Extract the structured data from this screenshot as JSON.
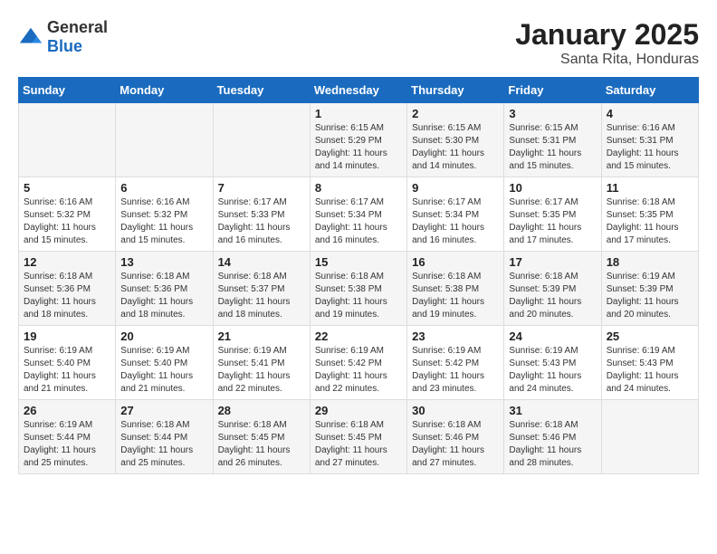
{
  "header": {
    "logo_general": "General",
    "logo_blue": "Blue",
    "month": "January 2025",
    "location": "Santa Rita, Honduras"
  },
  "days_of_week": [
    "Sunday",
    "Monday",
    "Tuesday",
    "Wednesday",
    "Thursday",
    "Friday",
    "Saturday"
  ],
  "weeks": [
    [
      {
        "day": "",
        "content": ""
      },
      {
        "day": "",
        "content": ""
      },
      {
        "day": "",
        "content": ""
      },
      {
        "day": "1",
        "content": "Sunrise: 6:15 AM\nSunset: 5:29 PM\nDaylight: 11 hours and 14 minutes."
      },
      {
        "day": "2",
        "content": "Sunrise: 6:15 AM\nSunset: 5:30 PM\nDaylight: 11 hours and 14 minutes."
      },
      {
        "day": "3",
        "content": "Sunrise: 6:15 AM\nSunset: 5:31 PM\nDaylight: 11 hours and 15 minutes."
      },
      {
        "day": "4",
        "content": "Sunrise: 6:16 AM\nSunset: 5:31 PM\nDaylight: 11 hours and 15 minutes."
      }
    ],
    [
      {
        "day": "5",
        "content": "Sunrise: 6:16 AM\nSunset: 5:32 PM\nDaylight: 11 hours and 15 minutes."
      },
      {
        "day": "6",
        "content": "Sunrise: 6:16 AM\nSunset: 5:32 PM\nDaylight: 11 hours and 15 minutes."
      },
      {
        "day": "7",
        "content": "Sunrise: 6:17 AM\nSunset: 5:33 PM\nDaylight: 11 hours and 16 minutes."
      },
      {
        "day": "8",
        "content": "Sunrise: 6:17 AM\nSunset: 5:34 PM\nDaylight: 11 hours and 16 minutes."
      },
      {
        "day": "9",
        "content": "Sunrise: 6:17 AM\nSunset: 5:34 PM\nDaylight: 11 hours and 16 minutes."
      },
      {
        "day": "10",
        "content": "Sunrise: 6:17 AM\nSunset: 5:35 PM\nDaylight: 11 hours and 17 minutes."
      },
      {
        "day": "11",
        "content": "Sunrise: 6:18 AM\nSunset: 5:35 PM\nDaylight: 11 hours and 17 minutes."
      }
    ],
    [
      {
        "day": "12",
        "content": "Sunrise: 6:18 AM\nSunset: 5:36 PM\nDaylight: 11 hours and 18 minutes."
      },
      {
        "day": "13",
        "content": "Sunrise: 6:18 AM\nSunset: 5:36 PM\nDaylight: 11 hours and 18 minutes."
      },
      {
        "day": "14",
        "content": "Sunrise: 6:18 AM\nSunset: 5:37 PM\nDaylight: 11 hours and 18 minutes."
      },
      {
        "day": "15",
        "content": "Sunrise: 6:18 AM\nSunset: 5:38 PM\nDaylight: 11 hours and 19 minutes."
      },
      {
        "day": "16",
        "content": "Sunrise: 6:18 AM\nSunset: 5:38 PM\nDaylight: 11 hours and 19 minutes."
      },
      {
        "day": "17",
        "content": "Sunrise: 6:18 AM\nSunset: 5:39 PM\nDaylight: 11 hours and 20 minutes."
      },
      {
        "day": "18",
        "content": "Sunrise: 6:19 AM\nSunset: 5:39 PM\nDaylight: 11 hours and 20 minutes."
      }
    ],
    [
      {
        "day": "19",
        "content": "Sunrise: 6:19 AM\nSunset: 5:40 PM\nDaylight: 11 hours and 21 minutes."
      },
      {
        "day": "20",
        "content": "Sunrise: 6:19 AM\nSunset: 5:40 PM\nDaylight: 11 hours and 21 minutes."
      },
      {
        "day": "21",
        "content": "Sunrise: 6:19 AM\nSunset: 5:41 PM\nDaylight: 11 hours and 22 minutes."
      },
      {
        "day": "22",
        "content": "Sunrise: 6:19 AM\nSunset: 5:42 PM\nDaylight: 11 hours and 22 minutes."
      },
      {
        "day": "23",
        "content": "Sunrise: 6:19 AM\nSunset: 5:42 PM\nDaylight: 11 hours and 23 minutes."
      },
      {
        "day": "24",
        "content": "Sunrise: 6:19 AM\nSunset: 5:43 PM\nDaylight: 11 hours and 24 minutes."
      },
      {
        "day": "25",
        "content": "Sunrise: 6:19 AM\nSunset: 5:43 PM\nDaylight: 11 hours and 24 minutes."
      }
    ],
    [
      {
        "day": "26",
        "content": "Sunrise: 6:19 AM\nSunset: 5:44 PM\nDaylight: 11 hours and 25 minutes."
      },
      {
        "day": "27",
        "content": "Sunrise: 6:18 AM\nSunset: 5:44 PM\nDaylight: 11 hours and 25 minutes."
      },
      {
        "day": "28",
        "content": "Sunrise: 6:18 AM\nSunset: 5:45 PM\nDaylight: 11 hours and 26 minutes."
      },
      {
        "day": "29",
        "content": "Sunrise: 6:18 AM\nSunset: 5:45 PM\nDaylight: 11 hours and 27 minutes."
      },
      {
        "day": "30",
        "content": "Sunrise: 6:18 AM\nSunset: 5:46 PM\nDaylight: 11 hours and 27 minutes."
      },
      {
        "day": "31",
        "content": "Sunrise: 6:18 AM\nSunset: 5:46 PM\nDaylight: 11 hours and 28 minutes."
      },
      {
        "day": "",
        "content": ""
      }
    ]
  ]
}
